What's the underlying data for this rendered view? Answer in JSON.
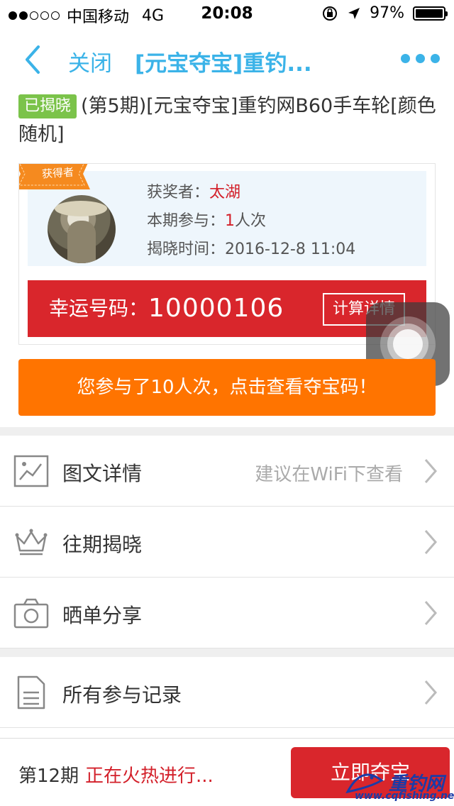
{
  "status_bar": {
    "carrier": "中国移动",
    "network": "4G",
    "time": "20:08",
    "battery": "97%"
  },
  "nav": {
    "close_label": "关闭",
    "title": "[元宝夺宝]重钓...",
    "accent_color": "#3bb3e8"
  },
  "product": {
    "badge": "已揭晓",
    "title": "(第5期)[元宝夺宝]重钓网B60手车轮[颜色随机]"
  },
  "winner": {
    "ribbon": "获得者",
    "winner_label": "获奖者：",
    "winner_name": "太湖",
    "participation_label": "本期参与：",
    "participation_count": "1",
    "participation_unit": "人次",
    "reveal_time_label": "揭晓时间：",
    "reveal_time": "2016-12-8 11:04",
    "lucky_label": "幸运号码：",
    "lucky_number": "10000106",
    "calc_button": "计算详情"
  },
  "participation_banner": "您参与了10人次，点击查看夺宝码！",
  "list": {
    "details": {
      "label": "图文详情",
      "hint": "建议在WiFi下查看",
      "icon": "image-icon"
    },
    "history": {
      "label": "往期揭晓",
      "icon": "crown-icon"
    },
    "share": {
      "label": "晒单分享",
      "icon": "camera-icon"
    },
    "records": {
      "label": "所有参与记录",
      "icon": "document-icon"
    }
  },
  "bottom_bar": {
    "period": "第12期",
    "status": "正在火热进行...",
    "action": "立即夺宝"
  },
  "watermark": {
    "name": "重钓网",
    "url": "www.cqfishing.net"
  },
  "colors": {
    "red": "#d9262c",
    "orange": "#ff7400",
    "green_badge": "#7bc34a"
  }
}
